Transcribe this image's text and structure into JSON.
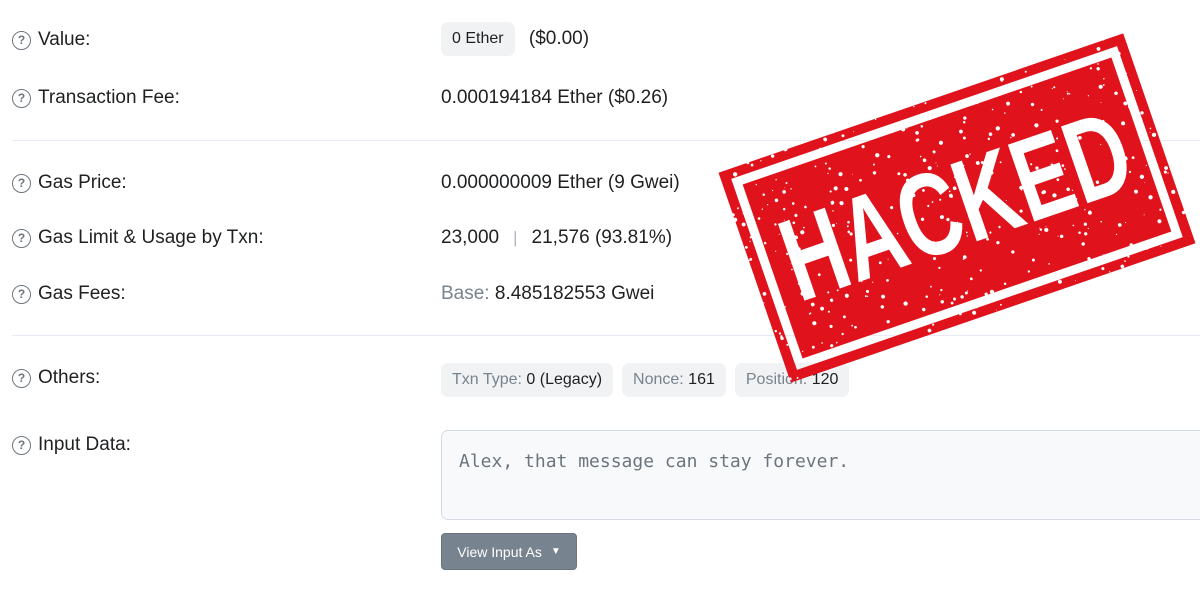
{
  "rows": {
    "value": {
      "label": "Value:",
      "amount_pill": "0 Ether",
      "usd": "($0.00)"
    },
    "fee": {
      "label": "Transaction Fee:",
      "value": "0.000194184 Ether ($0.26)"
    },
    "gas_price": {
      "label": "Gas Price:",
      "value": "0.000000009 Ether (9 Gwei)"
    },
    "gas_limit": {
      "label": "Gas Limit & Usage by Txn:",
      "limit": "23,000",
      "separator": "|",
      "usage": "21,576 (93.81%)"
    },
    "gas_fees": {
      "label": "Gas Fees:",
      "base_label": "Base:",
      "base_value": "8.485182553 Gwei"
    },
    "others": {
      "label": "Others:",
      "txn_type_label": "Txn Type:",
      "txn_type_value": "0 (Legacy)",
      "nonce_label": "Nonce:",
      "nonce_value": "161",
      "position_label": "Position:",
      "position_value": "120"
    },
    "input": {
      "label": "Input Data:",
      "text": "Alex, that message can stay forever.",
      "button": "View Input As",
      "button_icon": "chevron-down-icon"
    }
  },
  "icons": {
    "help": "question-circle-icon",
    "help_glyph": "?"
  },
  "stamp": {
    "text": "HACKED",
    "color": "#e0121b"
  }
}
